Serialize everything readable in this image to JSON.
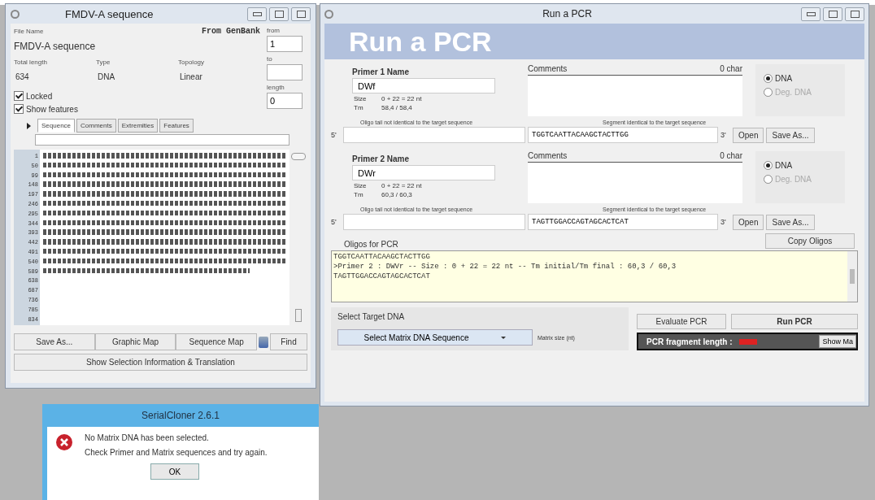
{
  "left_window": {
    "title": "FMDV-A sequence",
    "file_name_label": "File Name",
    "source": "From GenBank",
    "file_name": "FMDV-A sequence",
    "range": [
      {
        "label": "from",
        "value": "1"
      },
      {
        "label": "to"
      },
      {
        "label": "length",
        "value": "0"
      }
    ],
    "info": [
      {
        "label": "Total length",
        "value": "634"
      },
      {
        "label": "Type",
        "value": "DNA"
      },
      {
        "label": "Topology",
        "value": "Linear"
      }
    ],
    "checkboxes": [
      {
        "label": "Locked",
        "checked": true
      },
      {
        "label": "Show features",
        "checked": true
      }
    ],
    "tabs": [
      {
        "label": "Sequence",
        "selected": true
      },
      {
        "label": "Comments",
        "selected": false
      },
      {
        "label": "Extremities",
        "selected": false
      },
      {
        "label": "Features",
        "selected": false
      }
    ],
    "line_numbers": [
      "1",
      "50",
      "99",
      "148",
      "197",
      "246",
      "295",
      "344",
      "393",
      "442",
      "491",
      "540",
      "589",
      "638",
      "687",
      "736",
      "785",
      "834"
    ],
    "buttons": [
      "Save As...",
      "Graphic Map",
      "Sequence Map",
      "Find"
    ],
    "info_button": "Show Selection Information & Translation"
  },
  "dialog": {
    "title": "SerialCloner 2.6.1",
    "messages": [
      "No Matrix DNA has been selected.",
      "Check Primer and Matrix sequences and try again."
    ],
    "button": "OK"
  },
  "pcr_window": {
    "title": "Run a PCR",
    "banner": "Run a PCR",
    "primers": [
      {
        "name_label": "Primer 1 Name",
        "name": "DWf",
        "size_label": "Size",
        "size": "0 + 22 = 22 nt",
        "tm_label": "Tm",
        "tm": "58,4 / 58,4",
        "comments_label": "Comments",
        "char_count": "0 char",
        "types": [
          {
            "label": "DNA",
            "selected": true,
            "disabled": false
          },
          {
            "label": "Deg. DNA",
            "selected": false,
            "disabled": true
          }
        ],
        "tail_label": "Oligo tail not identical to the target sequence",
        "segment_label": "Segment identical to the target sequence",
        "five_prime": "5'",
        "segment": "TGGTCAATTACAAGCTACTTGG",
        "three_prime": "3'",
        "buttons": [
          "Open",
          "Save As..."
        ]
      },
      {
        "name_label": "Primer 2 Name",
        "name": "DWr",
        "size_label": "Size",
        "size": "0 + 22 = 22 nt",
        "tm_label": "Tm",
        "tm": "60,3 / 60,3",
        "comments_label": "Comments",
        "char_count": "0 char",
        "types": [
          {
            "label": "DNA",
            "selected": true,
            "disabled": false
          },
          {
            "label": "Deg. DNA",
            "selected": false,
            "disabled": true
          }
        ],
        "tail_label": "Oligo tail not identical to the target sequence",
        "segment_label": "Segment identical to the target sequence",
        "five_prime": "5'",
        "segment": "TAGTTGGACCAGTAGCACTCAT",
        "three_prime": "3'",
        "buttons": [
          "Open",
          "Save As..."
        ]
      }
    ],
    "oligos_label": "Oligos for PCR",
    "copy_button": "Copy Oligos",
    "oligos_lines": [
      "TGGTCAATTACAAGCTACTTGG",
      ">Primer 2 : DWVr -- Size : 0 + 22 = 22 nt -- Tm initial/Tm final : 60,3 / 60,3",
      "TAGTTGGACCAGTAGCACTCAT"
    ],
    "target_label": "Select Target DNA",
    "matrix_select": "Select Matrix DNA Sequence",
    "matrix_size_label": "Matrix size (nt)",
    "evaluate_button": "Evaluate PCR",
    "run_button": "Run PCR",
    "fragment_label": "PCR fragment length :",
    "show_button": "Show Ma"
  }
}
